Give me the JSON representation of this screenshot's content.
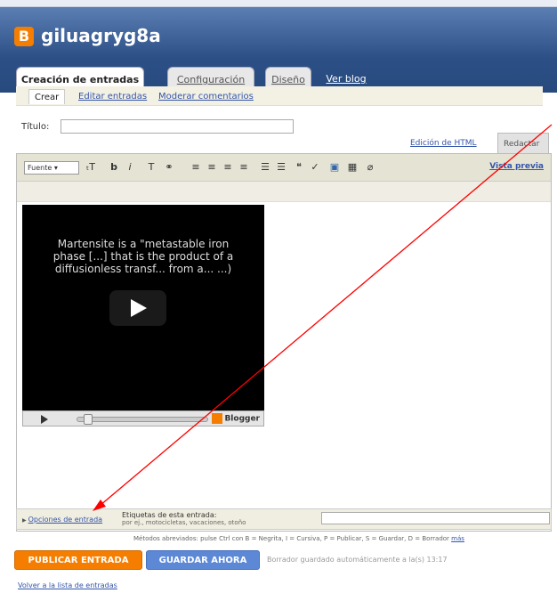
{
  "header": {
    "blog_name": "giluagryg8a",
    "logo_letter": "B"
  },
  "tabs": [
    {
      "label": "Creación de entradas"
    },
    {
      "label": "Configuración"
    },
    {
      "label": "Diseño"
    },
    {
      "label": "Ver blog"
    }
  ],
  "subtabs": [
    {
      "label": "Crear"
    },
    {
      "label": "Editar entradas"
    },
    {
      "label": "Moderar comentarios"
    }
  ],
  "post": {
    "title_label": "Título:",
    "title_value": ""
  },
  "modes": {
    "html_label": "Edición de HTML",
    "compose_label": "Redactar"
  },
  "toolbar": {
    "font_label": "Fuente",
    "preview_label": "Vista previa"
  },
  "video": {
    "caption": "Martensite is a \"metastable iron phase [...] that is the product of a diffusionless transf... from a... ...)",
    "brand_label": "Blogger"
  },
  "options": {
    "link_label": "Opciones de entrada",
    "labels_title": "Etiquetas de esta entrada:",
    "labels_hint": "por ej., motocicletas, vacaciones, otoño",
    "labels_value": ""
  },
  "shortcuts": {
    "text": "Métodos abreviados: pulse Ctrl con B = Negrita, I = Cursiva, P = Publicar, S = Guardar, D = Borrador",
    "more_label": "más"
  },
  "actions": {
    "publish_label": "PUBLICAR ENTRADA",
    "save_label": "GUARDAR AHORA",
    "autosave_text": "Borrador guardado automáticamente a la(s) 13:17"
  },
  "footer": {
    "back_link": "Volver a la lista de entradas"
  },
  "colors": {
    "accent_orange": "#f57d00",
    "header_blue": "#2c4f86",
    "save_blue": "#5c88d6",
    "annotation_red": "#ff0000"
  }
}
